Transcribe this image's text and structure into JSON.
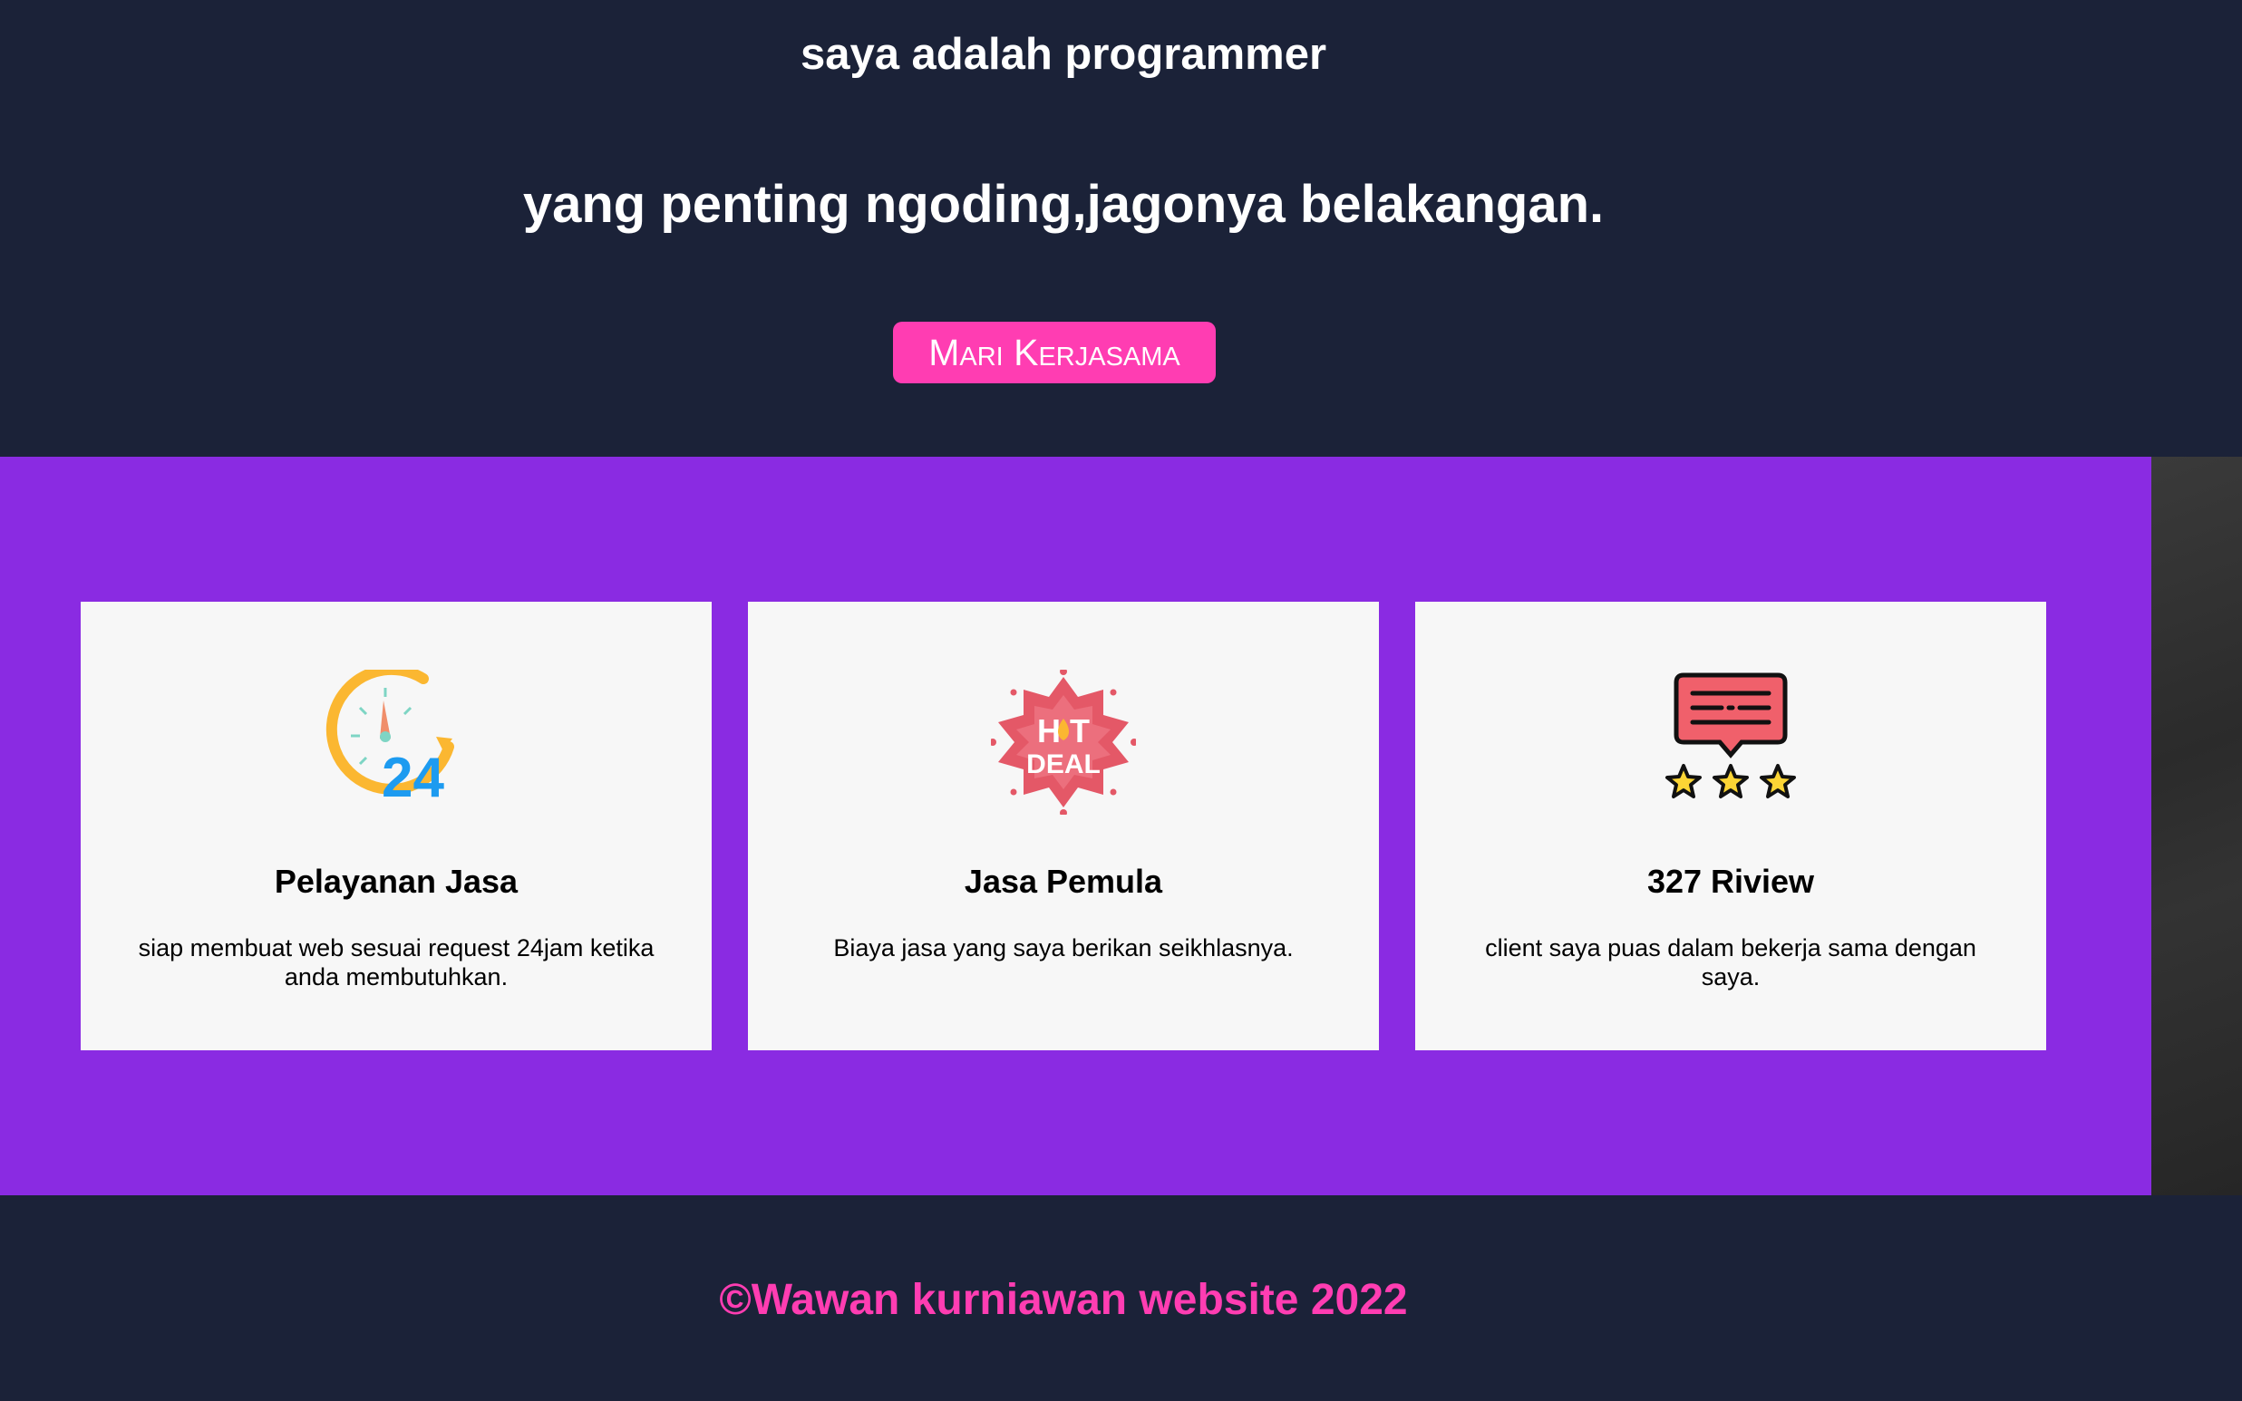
{
  "hero": {
    "subtitle": "saya adalah programmer",
    "title": "yang penting ngoding,jagonya belakangan.",
    "cta_label": "Mari Kerjasama"
  },
  "services": {
    "cards": [
      {
        "icon": "clock-24-icon",
        "title": "Pelayanan Jasa",
        "description": "siap membuat web sesuai request 24jam ketika anda membutuhkan."
      },
      {
        "icon": "hot-deal-icon",
        "icon_text_top": "H T",
        "icon_text_bottom": "DEAL",
        "title": "Jasa Pemula",
        "description": "Biaya jasa yang saya berikan seikhlasnya."
      },
      {
        "icon": "review-stars-icon",
        "title": "327 Riview",
        "description": "client saya puas dalam bekerja sama dengan saya."
      }
    ]
  },
  "footer": {
    "copyright": "©Wawan kurniawan website 2022"
  },
  "colors": {
    "background": "#1b2238",
    "accent": "#ff3db2",
    "services_bg": "#8a2be2",
    "card_bg": "#f7f7f7"
  }
}
